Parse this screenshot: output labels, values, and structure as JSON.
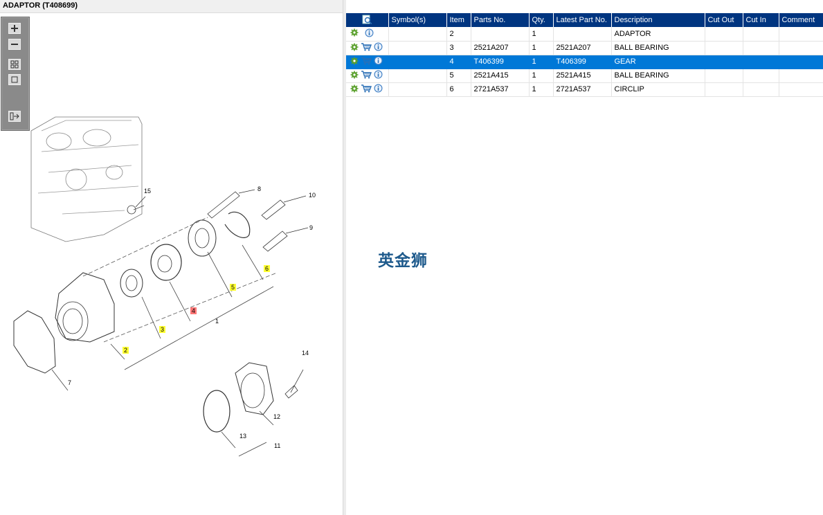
{
  "window": {
    "title": "ADAPTOR (T408699)"
  },
  "toolbar": {
    "buttons": [
      {
        "name": "zoom-in-icon"
      },
      {
        "name": "zoom-out-icon"
      },
      {
        "name": "fit-all-icon"
      },
      {
        "name": "actual-size-icon"
      },
      {
        "name": "export-icon"
      }
    ]
  },
  "diagram": {
    "callouts": [
      "15",
      "8",
      "10",
      "9",
      "6",
      "5",
      "4",
      "3",
      "2",
      "1",
      "7",
      "14",
      "12",
      "13",
      "11"
    ],
    "highlighted": {
      "yellow": [
        "2",
        "3",
        "5",
        "6"
      ],
      "red": [
        "4"
      ]
    }
  },
  "table": {
    "columns": [
      "",
      "Symbol(s)",
      "Item",
      "Parts No.",
      "Qty.",
      "Latest Part No.",
      "Description",
      "Cut Out",
      "Cut In",
      "Comment"
    ],
    "rows": [
      {
        "icons": [
          "gear-icon",
          "info-icon"
        ],
        "symbols": "",
        "item": "2",
        "part_no": "",
        "qty": "1",
        "latest": "",
        "description": "ADAPTOR",
        "cut_out": "",
        "cut_in": "",
        "comment": "",
        "selected": false
      },
      {
        "icons": [
          "gear-icon",
          "cart-icon",
          "info-icon"
        ],
        "symbols": "",
        "item": "3",
        "part_no": "2521A207",
        "qty": "1",
        "latest": "2521A207",
        "description": "BALL BEARING",
        "cut_out": "",
        "cut_in": "",
        "comment": "",
        "selected": false
      },
      {
        "icons": [
          "gear-icon",
          "cart-icon",
          "info-icon"
        ],
        "symbols": "",
        "item": "4",
        "part_no": "T406399",
        "qty": "1",
        "latest": "T406399",
        "description": "GEAR",
        "cut_out": "",
        "cut_in": "",
        "comment": "",
        "selected": true
      },
      {
        "icons": [
          "gear-icon",
          "cart-icon",
          "info-icon"
        ],
        "symbols": "",
        "item": "5",
        "part_no": "2521A415",
        "qty": "1",
        "latest": "2521A415",
        "description": "BALL BEARING",
        "cut_out": "",
        "cut_in": "",
        "comment": "",
        "selected": false
      },
      {
        "icons": [
          "gear-icon",
          "cart-icon",
          "info-icon"
        ],
        "symbols": "",
        "item": "6",
        "part_no": "2721A537",
        "qty": "1",
        "latest": "2721A537",
        "description": "CIRCLIP",
        "cut_out": "",
        "cut_in": "",
        "comment": "",
        "selected": false
      }
    ]
  },
  "watermark": "英金狮",
  "colors": {
    "header_bg": "#003580",
    "selected_row": "#0078d7",
    "highlight_yellow": "#ffff33",
    "highlight_red": "#ff7777"
  }
}
